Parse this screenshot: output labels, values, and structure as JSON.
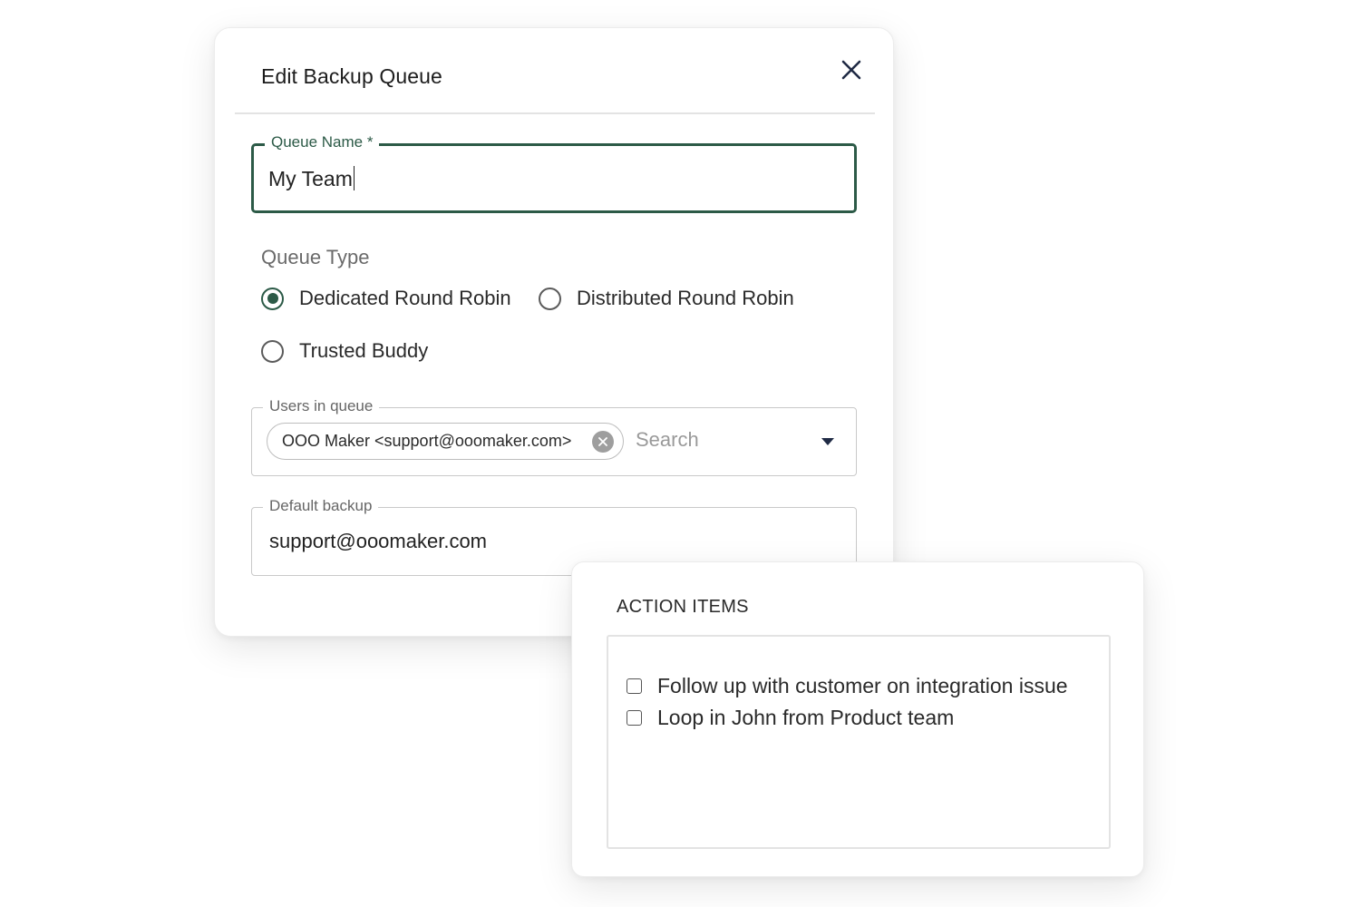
{
  "dialog": {
    "title": "Edit Backup Queue",
    "close_icon": "close-icon",
    "queue_name": {
      "label": "Queue Name *",
      "value": "My Team"
    },
    "queue_type": {
      "label": "Queue Type",
      "options": [
        {
          "label": "Dedicated Round Robin",
          "selected": true
        },
        {
          "label": "Distributed Round Robin",
          "selected": false
        },
        {
          "label": "Trusted Buddy",
          "selected": false
        }
      ]
    },
    "users_in_queue": {
      "label": "Users in queue",
      "chips": [
        {
          "label": "OOO Maker <support@ooomaker.com>"
        }
      ],
      "search_placeholder": "Search",
      "dropdown_icon": "caret-down-icon"
    },
    "default_backup": {
      "label": "Default backup",
      "value": "support@ooomaker.com"
    }
  },
  "action_items": {
    "title": "ACTION ITEMS",
    "items": [
      {
        "label": "Follow up with customer on integration issue",
        "checked": false
      },
      {
        "label": "Loop in John from Product team",
        "checked": false
      }
    ]
  },
  "colors": {
    "accent": "#2c5a47",
    "text": "#222222",
    "muted": "#6a6a6a",
    "border": "#c9c9c9"
  }
}
